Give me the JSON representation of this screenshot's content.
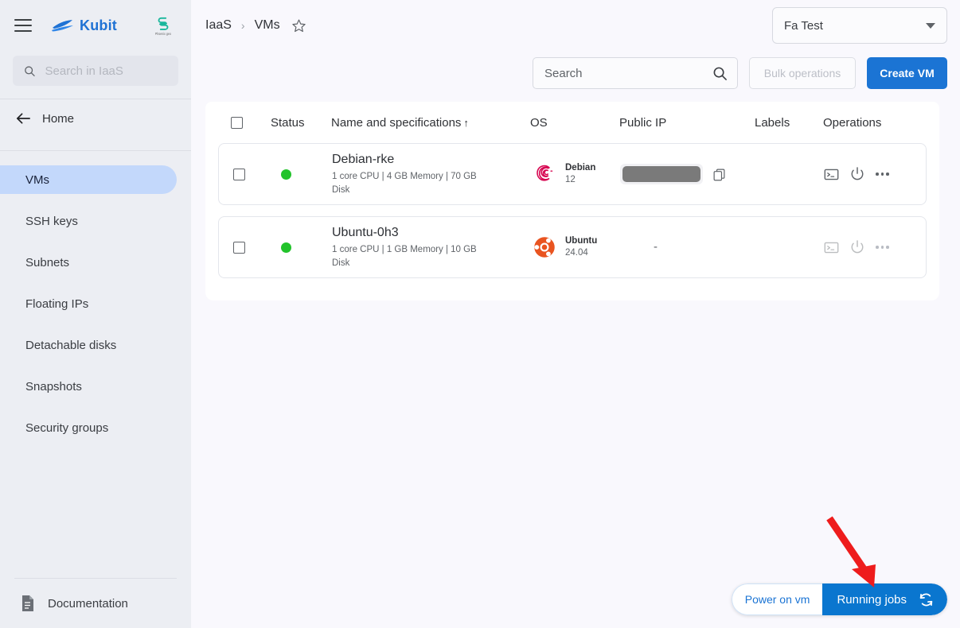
{
  "sidebar": {
    "menu_icon": "hamburger-icon",
    "brand": "Kubit",
    "partner_logo_text": "Phoenix geo",
    "search_placeholder": "Search in IaaS",
    "search_value": "",
    "search_icon": "search-icon",
    "back_icon": "arrow-left-icon",
    "home_label": "Home",
    "items": [
      {
        "label": "VMs",
        "active": true
      },
      {
        "label": "SSH keys",
        "active": false
      },
      {
        "label": "Subnets",
        "active": false
      },
      {
        "label": "Floating IPs",
        "active": false
      },
      {
        "label": "Detachable disks",
        "active": false
      },
      {
        "label": "Snapshots",
        "active": false
      },
      {
        "label": "Security groups",
        "active": false
      }
    ],
    "documentation_label": "Documentation",
    "documentation_icon": "document-icon"
  },
  "topbar": {
    "breadcrumb": {
      "root": "IaaS",
      "separator": "›",
      "current": "VMs"
    },
    "favorite_icon": "star-icon",
    "tenant": {
      "label": "Fa Test",
      "caret_icon": "chevron-down-icon"
    }
  },
  "actions": {
    "search_placeholder": "Search",
    "search_value": "",
    "search_icon": "search-icon",
    "bulk_operations_label": "Bulk operations",
    "bulk_operations_disabled": true,
    "create_vm_label": "Create VM"
  },
  "table": {
    "columns": {
      "select_all": "",
      "status": "Status",
      "name": "Name and specifications",
      "sort_indicator": "↑",
      "os": "OS",
      "public_ip": "Public IP",
      "labels": "Labels",
      "operations": "Operations"
    },
    "rows": [
      {
        "status": "running",
        "status_color": "#22c32b",
        "name": "Debian-rke",
        "specs": "1 core CPU | 4 GB Memory | 70 GB Disk",
        "os_name": "Debian",
        "os_version": "12",
        "os_icon": "debian-logo",
        "os_color": "#d70a53",
        "public_ip": "",
        "public_ip_masked": true,
        "copy_icon": "copy-icon",
        "labels": "",
        "operations": [
          "console-icon",
          "power-icon",
          "more-options-icon"
        ],
        "operations_enabled": true
      },
      {
        "status": "running",
        "status_color": "#22c32b",
        "name": "Ubuntu-0h3",
        "specs": "1 core CPU | 1 GB Memory | 10 GB Disk",
        "os_name": "Ubuntu",
        "os_version": "24.04",
        "os_icon": "ubuntu-logo",
        "os_color": "#E95420",
        "public_ip": "-",
        "public_ip_masked": false,
        "copy_icon": "",
        "labels": "",
        "operations": [
          "console-icon",
          "power-icon",
          "more-options-icon"
        ],
        "operations_enabled": false
      }
    ]
  },
  "jobs_widget": {
    "task_label": "Power on vm",
    "running_label": "Running jobs",
    "refresh_icon": "sync-icon",
    "accent_color": "#0a76cf"
  },
  "annotation": {
    "arrow_color": "#ee1c1c",
    "arrow_icon": "pointer-arrow"
  }
}
